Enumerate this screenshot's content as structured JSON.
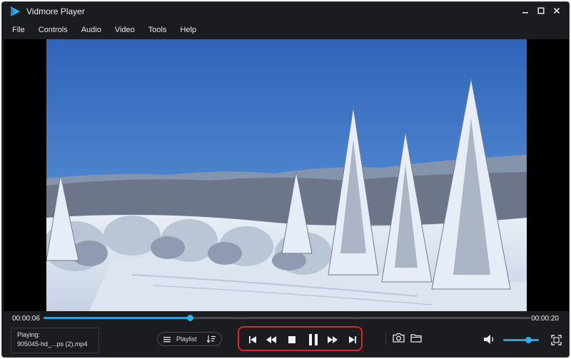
{
  "app": {
    "title": "Vidmore Player",
    "accent_color": "#29a3dd",
    "highlight_color": "#e02424"
  },
  "window_controls": {
    "minimize_icon": "minimize-icon",
    "maximize_icon": "maximize-icon",
    "close_icon": "close-icon"
  },
  "menu": [
    {
      "label": "File"
    },
    {
      "label": "Controls"
    },
    {
      "label": "Audio"
    },
    {
      "label": "Video"
    },
    {
      "label": "Tools"
    },
    {
      "label": "Help"
    }
  ],
  "video": {
    "scene": "snowy forest landscape under blue sky"
  },
  "playback": {
    "current_time": "00:00:06",
    "total_time": "00:00:20",
    "progress": 0.3
  },
  "now_playing": {
    "label": "Playing:",
    "file": "905045-hd_...ps (2).mp4"
  },
  "playlist": {
    "label": "Playlist"
  },
  "controls": [
    "skip-previous-icon",
    "rewind-icon",
    "stop-icon",
    "pause-icon",
    "fast-forward-icon",
    "skip-next-icon"
  ],
  "tools": [
    "snapshot-icon",
    "open-folder-icon"
  ],
  "volume": {
    "level": 0.7
  }
}
